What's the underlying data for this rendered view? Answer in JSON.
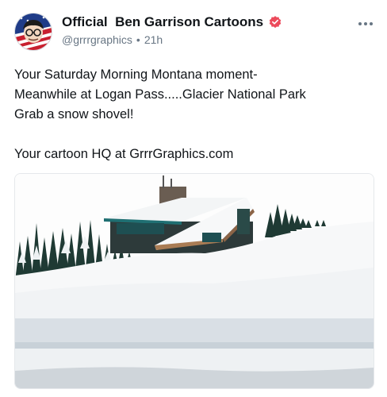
{
  "post": {
    "author_name": "Official  Ben Garrison Cartoons",
    "handle": "@grrrgraphics",
    "separator": "•",
    "time": "21h",
    "text_lines": [
      "Your Saturday Morning Montana moment-",
      "Meanwhile at Logan Pass.....Glacier National Park",
      "Grab a snow shovel!",
      "",
      "Your cartoon HQ at GrrrGraphics.com"
    ]
  },
  "icons": {
    "verified": "verified-badge-icon",
    "more": "more-options-icon",
    "avatar": "avatar-icon"
  },
  "colors": {
    "verified": "#ec4a5b",
    "text": "#101418",
    "muted": "#687684",
    "roof_trim": "#1f6f72"
  }
}
